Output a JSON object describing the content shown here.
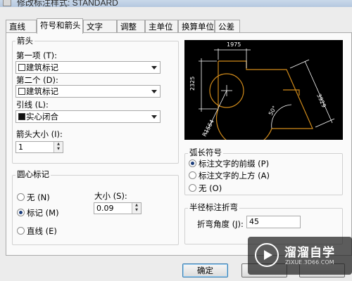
{
  "window": {
    "title": "修改标注样式: STANDARD"
  },
  "tabs": [
    {
      "label": "直线"
    },
    {
      "label": "符号和箭头"
    },
    {
      "label": "文字"
    },
    {
      "label": "调整"
    },
    {
      "label": "主单位"
    },
    {
      "label": "换算单位"
    },
    {
      "label": "公差"
    }
  ],
  "arrows": {
    "group_label": "箭头",
    "first_label": "第一项 (T):",
    "first_value": "建筑标记",
    "second_label": "第二个 (D):",
    "second_value": "建筑标记",
    "leader_label": "引线 (L):",
    "leader_value": "实心闭合",
    "size_label": "箭头大小 (I):",
    "size_value": "1"
  },
  "center_marks": {
    "group_label": "圆心标记",
    "options": [
      {
        "label": "无 (N)",
        "selected": false
      },
      {
        "label": "标记 (M)",
        "selected": true
      },
      {
        "label": "直线 (E)",
        "selected": false
      }
    ],
    "size_label": "大小 (S):",
    "size_value": "0.09"
  },
  "preview": {
    "dim_top": "1975",
    "dim_left": "2325",
    "dim_right": "3929",
    "dim_angle": "50°",
    "dim_radius": "R1564"
  },
  "arc_symbol": {
    "group_label": "弧长符号",
    "options": [
      {
        "label": "标注文字的前缀 (P)",
        "selected": true
      },
      {
        "label": "标注文字的上方 (A)",
        "selected": false
      },
      {
        "label": "无 (O)",
        "selected": false
      }
    ]
  },
  "radius_jog": {
    "group_label": "半径标注折弯",
    "angle_label": "折弯角度 (J):",
    "angle_value": "45"
  },
  "buttons": {
    "ok": "确定"
  },
  "watermark": {
    "main": "溜溜自学",
    "sub": "ZIXUE.3D66.COM"
  },
  "colors": {
    "preview_bg": "#000000",
    "preview_shape": "#d08a1a",
    "preview_dims": "#ffffff"
  }
}
